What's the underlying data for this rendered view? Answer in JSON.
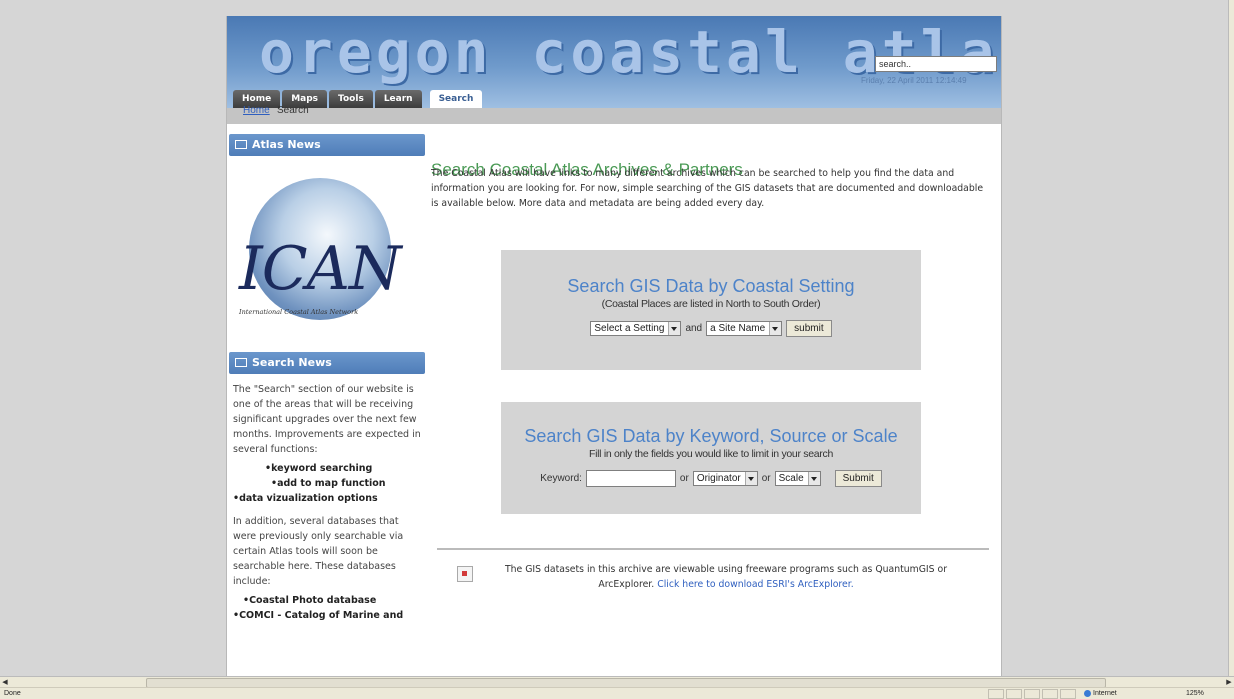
{
  "header": {
    "logo_text": "oregon coastal atlas",
    "search_value": "search..",
    "datetime": "Friday, 22 April 2011 12:14:49",
    "tabs": [
      "Home",
      "Maps",
      "Tools",
      "Learn",
      "Search"
    ],
    "active_tab": "Search"
  },
  "breadcrumb": {
    "home": "Home",
    "current": "Search"
  },
  "sidebar": {
    "atlas_news": {
      "heading": "Atlas News",
      "logo_text": "ICAN",
      "logo_subtitle": "International Coastal Atlas Network"
    },
    "search_news": {
      "heading": "Search News",
      "paragraph1": "The \"Search\" section of our website is one of the areas that will be receiving significant upgrades over the next few months. Improvements are expected in several functions:",
      "bullets": [
        "keyword searching",
        "add to map function",
        "data vizualization options"
      ],
      "paragraph2": "In addition, several databases that were previously only searchable via certain Atlas tools will soon be searchable here. These databases include:",
      "bullets2": [
        "Coastal Photo database",
        "COMCI - Catalog of Marine and"
      ]
    }
  },
  "main": {
    "title": "Search Coastal Atlas Archives & Partners",
    "intro": "The Coastal Atlas will have links to many different archives which can be searched to help you find the data and information you are looking for. For now, simple searching of the GIS datasets that are documented and downloadable is available below. More data and metadata are being added every day.",
    "setting_panel": {
      "heading": "Search GIS Data by Coastal Setting",
      "subheading": "(Coastal Places are listed in North to South Order)",
      "setting_select": "Select a Setting",
      "and_label": "and",
      "site_select": "a Site Name",
      "submit": "submit"
    },
    "keyword_panel": {
      "heading": "Search GIS Data by Keyword, Source or Scale",
      "subheading": "Fill in only the fields you would like to limit in your search",
      "keyword_label": "Keyword:",
      "or1": "or",
      "originator_select": "Originator",
      "or2": "or",
      "scale_select": "Scale",
      "submit": "Submit"
    },
    "note_text": "The GIS datasets in this archive are viewable using freeware programs such as QuantumGIS or ArcExplorer.",
    "note_link": "Click here to download ESRI's ArcExplorer."
  },
  "statusbar": {
    "status": "Done",
    "zone": "Internet",
    "zoom": "125%"
  }
}
